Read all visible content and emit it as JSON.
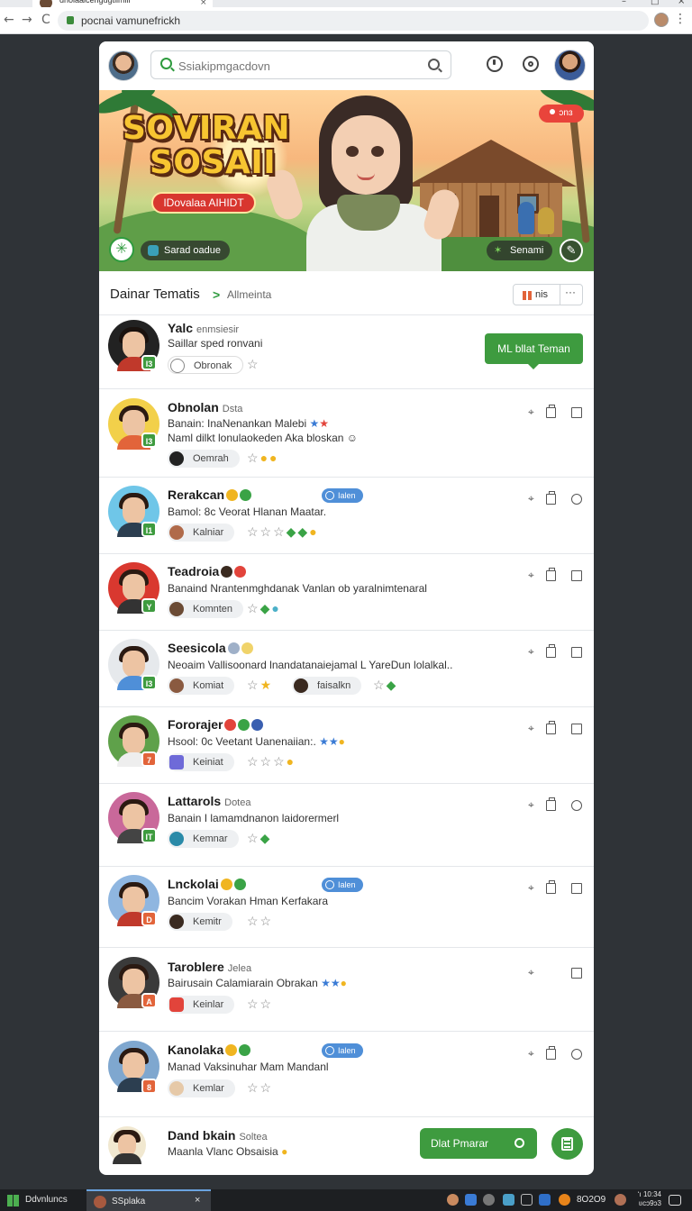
{
  "browser": {
    "tab_title": "dnolaaicengugtiimili",
    "url": "pocnai vamunefrickh",
    "nav": {
      "back": "←",
      "forward": "→",
      "reload": "C"
    }
  },
  "header": {
    "search_placeholder": "Ssiakipmgacdovn"
  },
  "banner": {
    "title_line1": "SOVIRAN",
    "title_line2": "SOSAII",
    "ribbon": "IDovalaa AIHIDT",
    "live_badge": "ɔnɜ",
    "left_pill": "Sarad oadue",
    "right_pill": "Senami"
  },
  "section": {
    "title": "Dainar Tematis",
    "chevron": ">",
    "subtitle": "Allmeinta",
    "tool_label": "nis",
    "more": "···"
  },
  "featured": {
    "name": "Yalc",
    "meta": "enmsiesir",
    "desc": "Saillar sped ronvani",
    "chip": "Obronak",
    "badge": "I3",
    "cta": "ML bllat Teman"
  },
  "rows": [
    {
      "name": "Obnolan",
      "meta": "Dsta",
      "desc": "Banain: InaNenankan Malebi",
      "desc2": "Naml dilkt lonulaokeden Aka bloskan ☺",
      "chip": "Oemrah",
      "badge": "I3",
      "tag": ""
    },
    {
      "name": "Rerakcan",
      "meta": "",
      "desc": "Bamol: 8c Veorat Hlanan Maatar.",
      "desc2": "",
      "chip": "Kalniar",
      "badge": "I1",
      "tag": "Ialen"
    },
    {
      "name": "Teadroia",
      "meta": "",
      "desc": "Banaind Nrantenmghdanak Vanlan ob yaralnimtenaral",
      "desc2": "",
      "chip": "Komnten",
      "badge": "Y",
      "tag": ""
    },
    {
      "name": "Seesicola",
      "meta": "",
      "desc": "Neoaim Vallisoonard lnandatanaiejamal L YareDun lolalkal..",
      "desc2": "",
      "chip": "Komiat",
      "chip2": "faisalkn",
      "badge": "I3",
      "tag": ""
    },
    {
      "name": "Fororajer",
      "meta": "",
      "desc": "Hsool: 0c Veetant Uanenaiian:.",
      "desc2": "",
      "chip": "Keiniat",
      "badge": "7",
      "tag": ""
    },
    {
      "name": "Lattarols",
      "meta": "Dotea",
      "desc": "Banain I lamamdnanon laidorermerl",
      "desc2": "",
      "chip": "Kemnar",
      "badge": "IT",
      "tag": ""
    },
    {
      "name": "Lnckolai",
      "meta": "",
      "desc": "Bancim Vorakan Hman Kerfakara",
      "desc2": "",
      "chip": "Kemitr",
      "badge": "D",
      "tag": "Ialen"
    },
    {
      "name": "Taroblere",
      "meta": "Jelea",
      "desc": "Bairusain Calamiarain Obrakan",
      "desc2": "",
      "chip": "Keinlar",
      "badge": "A",
      "tag": ""
    },
    {
      "name": "Kanolaka",
      "meta": "",
      "desc": "Manad Vaksinuhar Mam Mandanl",
      "desc2": "",
      "chip": "Kemlar",
      "badge": "8",
      "tag": "Ialen"
    },
    {
      "name": "Dand bkain",
      "meta": "Soltea",
      "desc": "Maanla Vlanc Obsaisia",
      "desc2": "",
      "chip": "",
      "badge": "",
      "tag": ""
    }
  ],
  "footer": {
    "primary_button": "Dlat Pmarar"
  },
  "taskbar": {
    "start_label": "Ddvnluncs",
    "app_label": "SSplaka",
    "close": "×",
    "tray_text": "8O2O9",
    "clock_time": "ʻı 10:34",
    "clock_date": "ɩıcɔ9ɔ3"
  },
  "colors": {
    "accent_green": "#3e9b3f",
    "tag_blue": "#4f8fd8",
    "live_red": "#e9443b"
  }
}
